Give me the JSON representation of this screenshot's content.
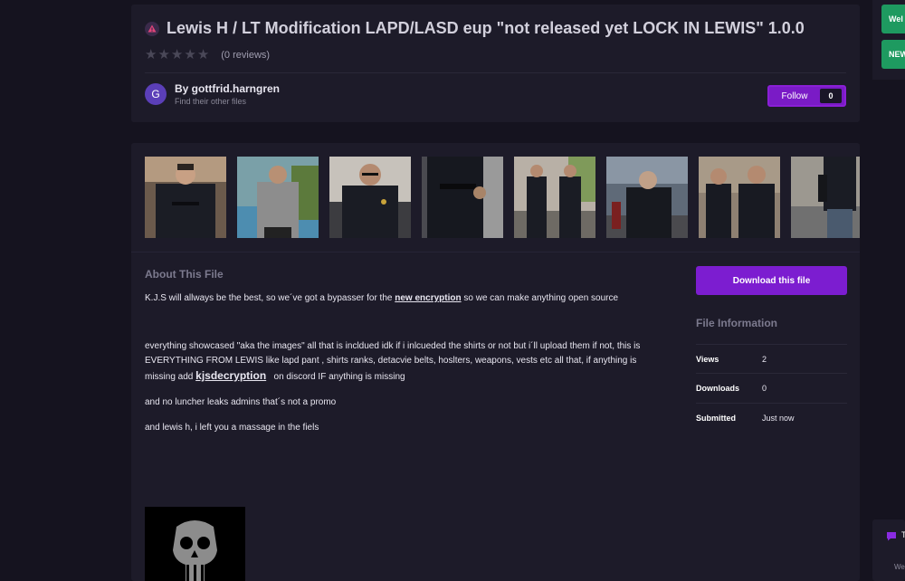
{
  "file": {
    "title": "Lewis H / LT Modification LAPD/LASD eup \"not released yet LOCK IN LEWIS\" 1.0.0",
    "reviews": "(0 reviews)",
    "rating": 0
  },
  "author": {
    "initial": "G",
    "by_line": "By gottfrid.harngren",
    "sub": "Find their other files"
  },
  "follow": {
    "label": "Follow",
    "count": "0"
  },
  "about": {
    "heading": "About This File",
    "p1_text": "K.J.S will allways be the best, so we´ve got a bypasser for the",
    "p1_link": "new encryption",
    "p1_tail": "so  we can make anything open source",
    "p2_text": "everything showcased \"aka the images\" all that is incldued idk if i inlcueded the shirts or not but i´ll upload them if not, this is EVERYTHING FROM LEWIS  like lapd pant , shirts ranks, detacvie belts, hoslters, weapons, vests etc all that, if anything is missing add",
    "p2_link": "kjsdecryption",
    "p2_tail": "on discord IF anything is missing",
    "p3": "and no luncher leaks admins that´s not a promo",
    "p4": "and lewis h, i left you a massage in the fiels"
  },
  "download": {
    "label": "Download this file"
  },
  "info": {
    "heading": "File Information",
    "rows": [
      {
        "key": "Views",
        "value": "2"
      },
      {
        "key": "Downloads",
        "value": "0"
      },
      {
        "key": "Submitted",
        "value": "Just now"
      }
    ]
  },
  "side": {
    "btn1": "Wel",
    "btn2": "NEW",
    "chat_t": "T",
    "chat_sub": "We"
  },
  "colors": {
    "accent": "#7c1dd0",
    "panel": "#1d1b29",
    "background": "#15131f",
    "green": "#1e9a60"
  }
}
